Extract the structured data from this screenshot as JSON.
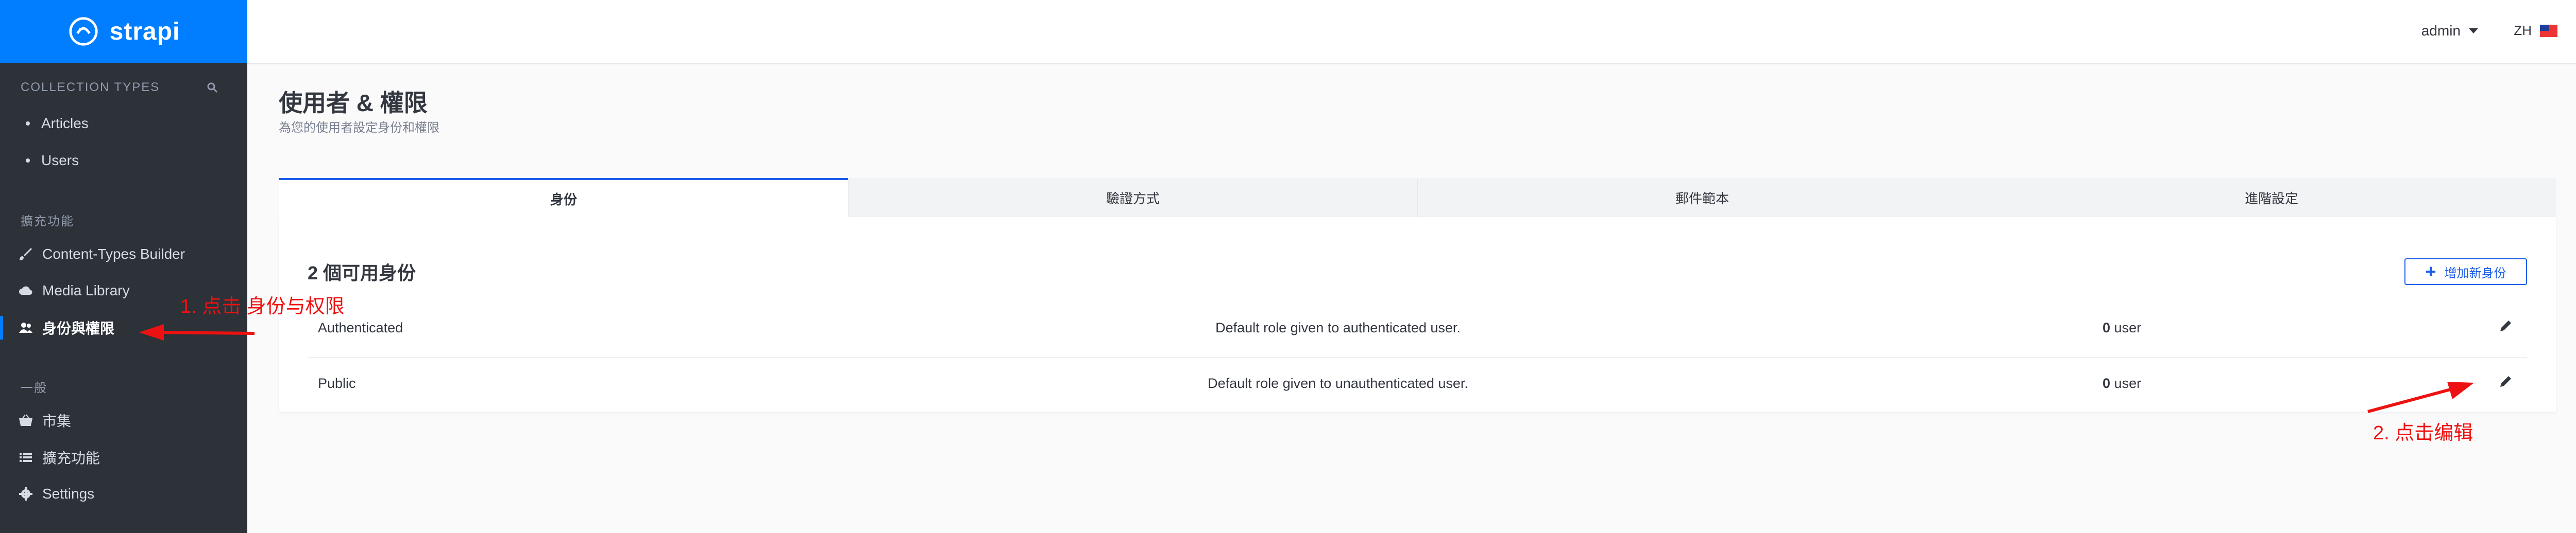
{
  "brand": {
    "name": "strapi"
  },
  "sidebar": {
    "section_collection": "COLLECTION TYPES",
    "collection_items": [
      {
        "label": "Articles"
      },
      {
        "label": "Users"
      }
    ],
    "section_plugins": "擴充功能",
    "plugin_items": [
      {
        "label": "Content-Types Builder",
        "icon": "paintbrush-icon"
      },
      {
        "label": "Media Library",
        "icon": "cloud-upload-icon"
      },
      {
        "label": "身份與權限",
        "icon": "users-icon"
      }
    ],
    "section_general": "一般",
    "general_items": [
      {
        "label": "市集",
        "icon": "basket-icon"
      },
      {
        "label": "擴充功能",
        "icon": "list-icon"
      },
      {
        "label": "Settings",
        "icon": "gear-icon"
      }
    ]
  },
  "topbar": {
    "user": "admin",
    "lang": "ZH"
  },
  "page": {
    "title": "使用者 & 權限",
    "subtitle": "為您的使用者設定身份和權限"
  },
  "tabs": [
    "身份",
    "驗證方式",
    "郵件範本",
    "進階設定"
  ],
  "roles": {
    "heading": "2 個可用身份",
    "add_button": "增加新身份",
    "rows": [
      {
        "name": "Authenticated",
        "description": "Default role given to authenticated user.",
        "count": "0",
        "unit": "user"
      },
      {
        "name": "Public",
        "description": "Default role given to unauthenticated user.",
        "count": "0",
        "unit": "user"
      }
    ]
  },
  "annotations": {
    "step1": "1. 点击 身份与权限",
    "step2": "2. 点击编辑",
    "color": "#ee1111"
  },
  "colors": {
    "accent": "#007eff",
    "sidebar_bg": "#2d3138",
    "button": "#1c5de7"
  }
}
